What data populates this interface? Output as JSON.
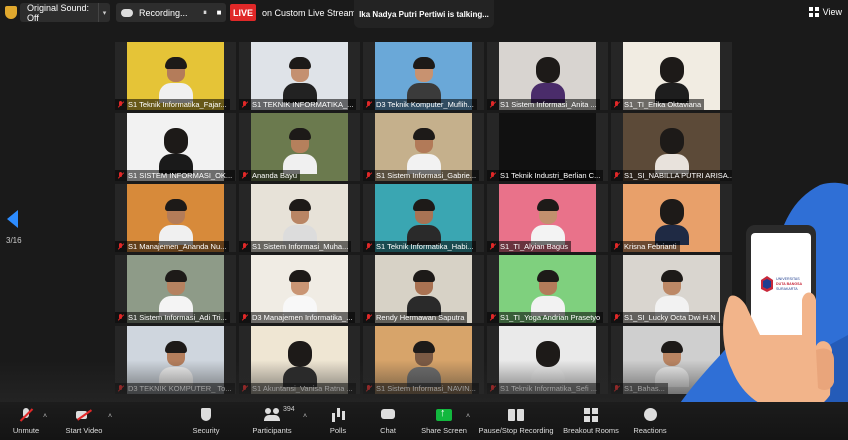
{
  "topbar": {
    "sound_label": "Original Sound: Off",
    "recording_label": "Recording...",
    "pause_glyph": "⏸",
    "stop_glyph": "■",
    "live_badge": "LIVE",
    "live_text": "on Custom Live Streaming Service",
    "talking": "Ika Nadya Putri Pertiwi is talking...",
    "view_label": "View",
    "caret": "▾"
  },
  "pager": {
    "page": "3/16"
  },
  "participants": [
    {
      "name": "S1 Teknik Informatika_Fajar...",
      "bg": "#e5c437",
      "skin": "#b47c5a",
      "shirt": "#f0f0f0",
      "hijab": false
    },
    {
      "name": "S1 TEKNIK INFORMATIKA_...",
      "bg": "#dfe3e8",
      "skin": "#c49070",
      "shirt": "#222222",
      "hijab": false
    },
    {
      "name": "D3 Teknik Komputer_Muflih...",
      "bg": "#6aa8d8",
      "skin": "#c89270",
      "shirt": "#3b3b3b",
      "hijab": false
    },
    {
      "name": "S1 Sistem Informasi_Anita ...",
      "bg": "#d8d4d0",
      "skin": "#c99978",
      "shirt": "#4a2c6a",
      "hijab": true
    },
    {
      "name": "S1_TI_Erika Oktaviana",
      "bg": "#f1ece2",
      "skin": "#c48f6c",
      "shirt": "#1e1e1e",
      "hijab": true
    },
    {
      "name": "S1 SISTEM INFORMASI_OK...",
      "bg": "#f2f2f2",
      "skin": "#c6946f",
      "shirt": "#1a1a1a",
      "hijab": true
    },
    {
      "name": "Ananda Bayu",
      "bg": "#6b7a4e",
      "skin": "#b5805c",
      "shirt": "#f0f0f0",
      "hijab": false
    },
    {
      "name": "S1 Sistem Informasi_Gabrie...",
      "bg": "#c5b08c",
      "skin": "#b27a58",
      "shirt": "#f2f2f2",
      "hijab": false
    },
    {
      "name": "S1 Teknik Industri_Berlian C...",
      "bg": "#111111",
      "skin": "#111111",
      "shirt": "#111111",
      "hijab": false
    },
    {
      "name": "S1_SI_NABILLA PUTRI ARISA...",
      "bg": "#5c4a38",
      "skin": "#d2a07c",
      "shirt": "#e8e2dc",
      "hijab": true
    },
    {
      "name": "S1 Manajemen_Ananda Nu...",
      "bg": "#d78a3a",
      "skin": "#b47c58",
      "shirt": "#f0f0f0",
      "hijab": false
    },
    {
      "name": "S1 Sistem Informasi_Muha...",
      "bg": "#e7e2d8",
      "skin": "#b98564",
      "shirt": "#dcdcdc",
      "hijab": false
    },
    {
      "name": "S1 Teknik Informatika_Habi...",
      "bg": "#3aa6b2",
      "skin": "#a87354",
      "shirt": "#2a2a2a",
      "hijab": false
    },
    {
      "name": "S1_TI_Alyian Bagus",
      "bg": "#e9728a",
      "skin": "#c2906e",
      "shirt": "#f3f3f3",
      "hijab": false
    },
    {
      "name": "Krisna Febrianti",
      "bg": "#e8a06a",
      "skin": "#c99574",
      "shirt": "#1f2a44",
      "hijab": true
    },
    {
      "name": "S1 Sistem Informasi_Adi Tri...",
      "bg": "#8e9b88",
      "skin": "#b58260",
      "shirt": "#f4f4f4",
      "hijab": false
    },
    {
      "name": "D3 Manajemen Informatika_...",
      "bg": "#f0ece4",
      "skin": "#c99574",
      "shirt": "#f8f8f8",
      "hijab": false
    },
    {
      "name": "Rendy Hermawan Saputra",
      "bg": "#d7d2c6",
      "skin": "#a97252",
      "shirt": "#2a2a2a",
      "hijab": false
    },
    {
      "name": "S1_TI_Yoga Andrian Prasetyo",
      "bg": "#7fd07e",
      "skin": "#b37c5a",
      "shirt": "#f2f2f2",
      "hijab": false
    },
    {
      "name": "S1_SI_Lucky Octa Dwi H.N",
      "bg": "#d9d5cf",
      "skin": "#bc8866",
      "shirt": "#f2f2f2",
      "hijab": false
    },
    {
      "name": "D3 TEKNIK KOMPUTER_ To...",
      "bg": "#cfd6de",
      "skin": "#b47e5c",
      "shirt": "#f2f2f2",
      "hijab": false
    },
    {
      "name": "S1 Akuntansi_Vanisa Ratna ...",
      "bg": "#efe6d3",
      "skin": "#c79472",
      "shirt": "#2b2b2b",
      "hijab": true
    },
    {
      "name": "S1 Sistem Informasi_NAVIN...",
      "bg": "#d7a46a",
      "skin": "#7b5a44",
      "shirt": "#6e6e6e",
      "hijab": false
    },
    {
      "name": "S1 Teknik Informatika_Sefi ...",
      "bg": "#eaeaea",
      "skin": "#c89574",
      "shirt": "#eeeeee",
      "hijab": true
    },
    {
      "name": "S1_Bahas...",
      "bg": "#cfcfcf",
      "skin": "#b98462",
      "shirt": "#eeeeee",
      "hijab": false
    }
  ],
  "toolbar": {
    "unmute": "Unmute",
    "start_video": "Start Video",
    "security": "Security",
    "participants": "Participants",
    "participant_count": "394",
    "polls": "Polls",
    "chat": "Chat",
    "share_screen": "Share Screen",
    "pause_stop_recording": "Pause/Stop Recording",
    "breakout_rooms": "Breakout Rooms",
    "reactions": "Reactions",
    "caret_up": "˄"
  },
  "overlay": {
    "university_line1": "UNIVERSITAS",
    "university_line2": "DUTA BANGSA",
    "university_line3": "SURAKARTA"
  },
  "colors": {
    "live_red": "#e02828",
    "nav_blue": "#2d8cff",
    "share_green": "#12b83e",
    "deco_blue": "#2f6fd6"
  }
}
